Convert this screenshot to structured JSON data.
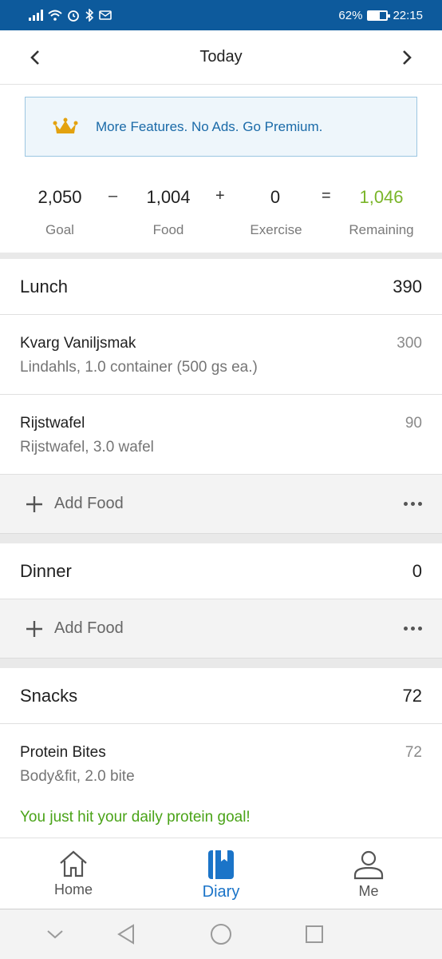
{
  "status_bar": {
    "battery_text": "62%",
    "battery_level": 0.62,
    "time": "22:15",
    "icons": [
      "signal-icon",
      "wifi-icon",
      "alarm-icon",
      "bluetooth-icon",
      "notification-icon"
    ]
  },
  "header": {
    "title": "Today",
    "prev_icon": "chevron-left-icon",
    "next_icon": "chevron-right-icon"
  },
  "premium": {
    "text": "More Features. No Ads. Go Premium.",
    "icon": "crown-icon",
    "icon_color": "#e3a20f"
  },
  "summary": {
    "goal": "2,050",
    "goal_label": "Goal",
    "minus": "–",
    "food": "1,004",
    "food_label": "Food",
    "plus": "+",
    "exercise": "0",
    "exercise_label": "Exercise",
    "equals": "=",
    "remaining": "1,046",
    "remaining_label": "Remaining",
    "remaining_color": "#7ab529"
  },
  "lunch": {
    "title": "Lunch",
    "total": "390",
    "items": [
      {
        "name": "Kvarg Vaniljsmak",
        "desc": "Lindahls, 1.0 container (500 gs ea.)",
        "cal": "300"
      },
      {
        "name": "Rijstwafel",
        "desc": "Rijstwafel, 3.0 wafel",
        "cal": "90"
      }
    ],
    "add_label": "Add Food"
  },
  "dinner": {
    "title": "Dinner",
    "total": "0",
    "add_label": "Add Food"
  },
  "snacks": {
    "title": "Snacks",
    "total": "72",
    "items": [
      {
        "name": "Protein Bites",
        "desc": "Body&fit, 2.0 bite",
        "cal": "72"
      }
    ],
    "message": "You just hit your daily protein goal!",
    "message_color": "#4aa318"
  },
  "bottom_nav": {
    "items": [
      {
        "label": "Home",
        "icon": "home-icon"
      },
      {
        "label": "Diary",
        "icon": "diary-icon",
        "active": true
      },
      {
        "label": "Me",
        "icon": "profile-icon"
      }
    ],
    "active_color": "#1b74c8"
  },
  "system_nav": {
    "icons": [
      "collapse-icon",
      "back-icon",
      "home-circle-icon",
      "recents-icon"
    ]
  },
  "colors": {
    "status_bar": "#0d5a9c",
    "accent": "#1b74c8",
    "premium_bg": "#eef6fb"
  }
}
